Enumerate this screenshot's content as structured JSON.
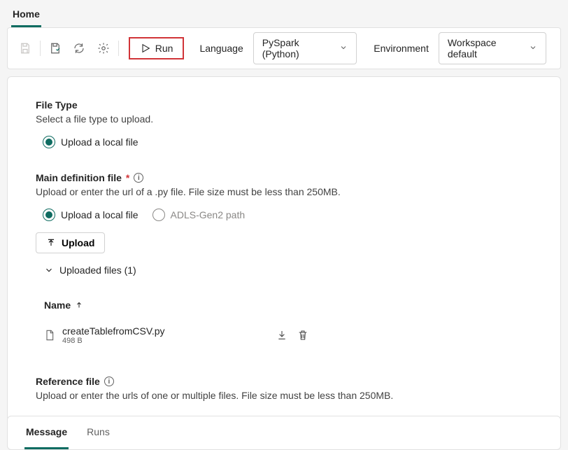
{
  "topTab": "Home",
  "toolbar": {
    "run": "Run",
    "languageLabel": "Language",
    "languageValue": "PySpark (Python)",
    "envLabel": "Environment",
    "envValue": "Workspace default"
  },
  "fileType": {
    "title": "File Type",
    "desc": "Select a file type to upload.",
    "option1": "Upload a local file"
  },
  "mainDef": {
    "title": "Main definition file",
    "desc": "Upload or enter the url of a .py file. File size must be less than 250MB.",
    "option1": "Upload a local file",
    "option2": "ADLS-Gen2 path",
    "uploadBtn": "Upload",
    "uploadedLabel": "Uploaded files (1)",
    "colName": "Name",
    "file": {
      "name": "createTablefromCSV.py",
      "size": "498 B"
    }
  },
  "refFile": {
    "title": "Reference file",
    "desc": "Upload or enter the urls of one or multiple files. File size must be less than 250MB."
  },
  "bottomTabs": {
    "message": "Message",
    "runs": "Runs"
  }
}
